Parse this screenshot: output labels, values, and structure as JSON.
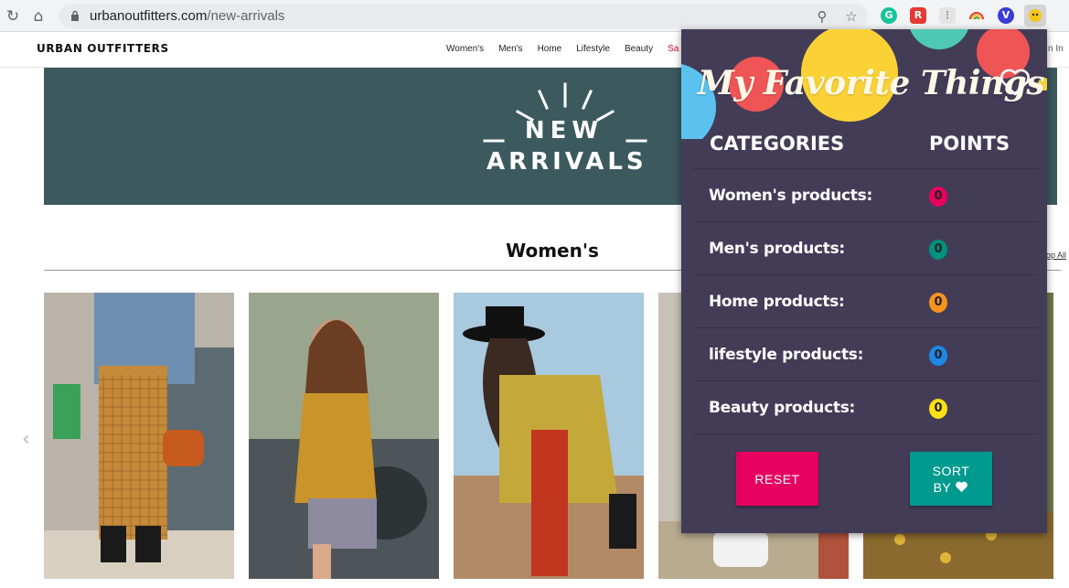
{
  "browser": {
    "url_domain": "urbanoutfitters.com",
    "url_path": "/new-arrivals",
    "extensions": [
      {
        "name": "grammarly",
        "letter": "G",
        "color": "#15c39a"
      },
      {
        "name": "readwise",
        "letter": "R",
        "color": "#e53935"
      },
      {
        "name": "grid",
        "letter": "",
        "color": "#d0d0d0"
      },
      {
        "name": "rainbow",
        "letter": "",
        "color": "#f0f0f0"
      },
      {
        "name": "v-ext",
        "letter": "V",
        "color": "#3b3bd6"
      },
      {
        "name": "favorite-things",
        "letter": "",
        "color": "#cfcfcf"
      }
    ]
  },
  "site": {
    "logo": "URBAN OUTFITTERS",
    "nav": [
      "Women's",
      "Men's",
      "Home",
      "Lifestyle",
      "Beauty",
      "Sa"
    ],
    "signin": "n In",
    "banner_line1": "NEW",
    "banner_line2": "ARRIVALS",
    "section_title": "Women's",
    "shop_all": "op All"
  },
  "popup": {
    "title": "My Favorite Things",
    "col_categories": "CATEGORIES",
    "col_points": "POINTS",
    "rows": [
      {
        "label": "Women's products:",
        "points": "0",
        "color": "#e8005e"
      },
      {
        "label": "Men's products:",
        "points": "0",
        "color": "#00917f"
      },
      {
        "label": "Home products:",
        "points": "0",
        "color": "#f7931e"
      },
      {
        "label": "lifestyle products:",
        "points": "0",
        "color": "#1e88e5"
      },
      {
        "label": "Beauty products:",
        "points": "0",
        "color": "#ffe014"
      }
    ],
    "reset_label": "RESET",
    "sort_label_1": "SORT",
    "sort_label_2": "BY",
    "colors": {
      "bg": "#433c57",
      "reset": "#e6005f",
      "sort": "#009a8e"
    }
  }
}
